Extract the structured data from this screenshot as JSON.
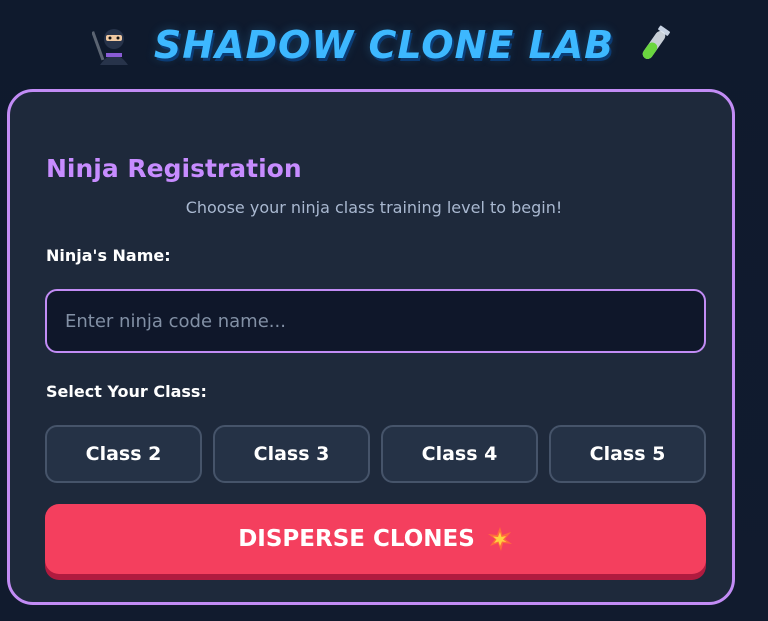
{
  "header": {
    "title": "SHADOW CLONE LAB",
    "left_icon": "ninja-icon",
    "right_icon": "test-tube-icon"
  },
  "registration": {
    "heading": "Ninja Registration",
    "subtitle": "Choose your ninja class training level to begin!",
    "name_label": "Ninja's Name:",
    "name_placeholder": "Enter ninja code name...",
    "name_value": "",
    "class_label": "Select Your Class:",
    "classes": [
      {
        "label": "Class 2"
      },
      {
        "label": "Class 3"
      },
      {
        "label": "Class 4"
      },
      {
        "label": "Class 5"
      }
    ]
  },
  "action": {
    "label": "DISPERSE CLONES",
    "icon": "collision-icon"
  },
  "colors": {
    "accent": "#c28cf5",
    "title": "#3db8ff",
    "button": "#f43f5e",
    "card": "#1e293b"
  }
}
